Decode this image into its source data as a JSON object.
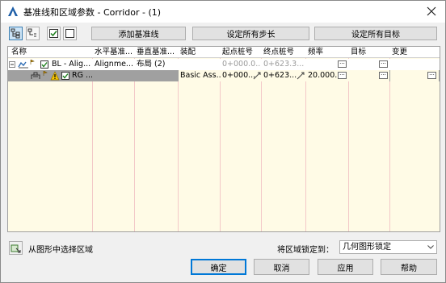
{
  "window": {
    "title": "基准线和区域参数 - Corridor - (1)"
  },
  "toolbar": {
    "add_baseline": "添加基准线",
    "set_all_frequencies": "设定所有步长",
    "set_all_targets": "设定所有目标"
  },
  "grid": {
    "columns": [
      "名称",
      "水平基准...",
      "垂直基准...",
      "装配",
      "起点桩号",
      "终点桩号",
      "频率",
      "目标",
      "变更"
    ],
    "rows": [
      {
        "name": "BL - Alig...",
        "horizontal": "Alignme...",
        "vertical": "布局 (2)",
        "assembly": "",
        "start": "0+000.0...",
        "end": "0+623.3...",
        "frequency": "",
        "target": "",
        "override": ""
      },
      {
        "name": "RG ...",
        "horizontal": "",
        "vertical": "",
        "assembly": "Basic Ass...",
        "start": "0+000...",
        "end": "0+623...",
        "frequency": "20.000...",
        "target": "",
        "override": ""
      }
    ],
    "ellipsis": "···"
  },
  "footer": {
    "pick_region": "从图形中选择区域",
    "lock_regions_label": "将区域锁定到：",
    "lock_regions_value": "几何图形锁定",
    "ok": "确定",
    "cancel": "取消",
    "apply": "应用",
    "help": "帮助"
  }
}
